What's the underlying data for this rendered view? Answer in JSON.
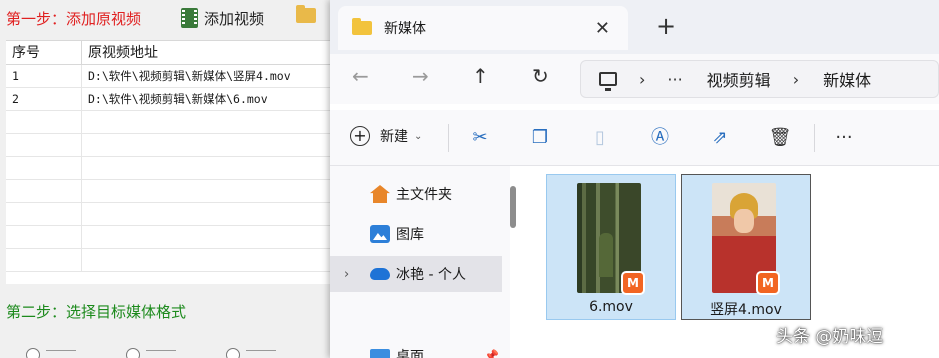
{
  "converter": {
    "step1_label": "第一步：添加原视频",
    "add_video_label": "添加视频",
    "table": {
      "headers": [
        "序号",
        "原视频地址"
      ],
      "rows": [
        [
          "1",
          "D:\\软件\\视频剪辑\\新媒体\\竖屏4.mov"
        ],
        [
          "2",
          "D:\\软件\\视频剪辑\\新媒体\\6.mov"
        ]
      ]
    },
    "step2_label": "第二步：选择目标媒体格式"
  },
  "explorer": {
    "tab_title": "新媒体",
    "breadcrumb": [
      "视频剪辑",
      "新媒体"
    ],
    "commands": {
      "new_label": "新建"
    },
    "nav_pane": [
      {
        "label": "主文件夹",
        "icon": "home-icon"
      },
      {
        "label": "图库",
        "icon": "gallery-icon"
      },
      {
        "label": "冰艳 - 个人",
        "icon": "onedrive-cloud-icon"
      },
      {
        "label": "桌面",
        "icon": "desktop-icon"
      }
    ],
    "files": [
      {
        "name": "6.mov",
        "icon": "video-file-icon"
      },
      {
        "name": "竖屏4.mov",
        "icon": "video-file-icon"
      }
    ],
    "accent_color": "#2a6fbf",
    "selection_color": "#cce4f7"
  },
  "watermark": "头条 @奶味逗"
}
